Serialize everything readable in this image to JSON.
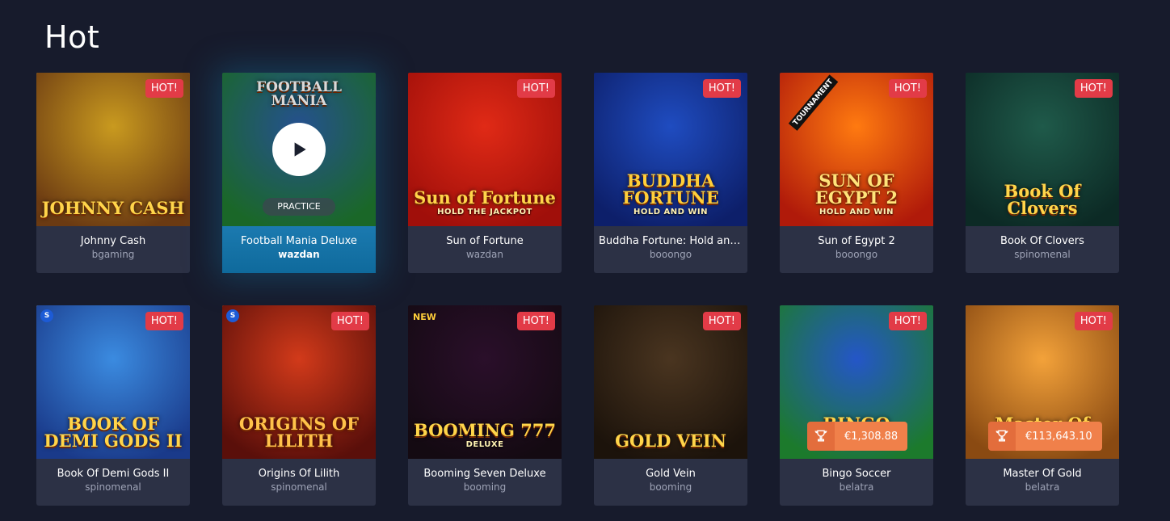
{
  "section": {
    "title": "Hot"
  },
  "games": [
    {
      "name": "Johnny Cash",
      "provider": "bgaming",
      "badge": "HOT!",
      "art_title": "JOHNNY CASH",
      "art_sub": "",
      "bg": [
        "#c99a1f",
        "#6b3a12"
      ],
      "border": "#f6c431",
      "title_color": "#ffd54a"
    },
    {
      "name": "Football Mania Deluxe",
      "provider": "wazdan",
      "badge": "",
      "art_title": "FOOTBALL MANIA",
      "art_sub": "",
      "practice": "PRACTICE",
      "bg": [
        "#2c5fa8",
        "#1f7a2f"
      ],
      "border": "",
      "title_color": "#ffffff"
    },
    {
      "name": "Sun of Fortune",
      "provider": "wazdan",
      "badge": "HOT!",
      "art_title": "Sun of Fortune",
      "art_sub": "HOLD THE JACKPOT",
      "bg": [
        "#e02a16",
        "#a00f0a"
      ],
      "border": "",
      "title_color": "#ffd54a"
    },
    {
      "name": "Buddha Fortune: Hold and ...",
      "provider": "booongo",
      "badge": "HOT!",
      "art_title": "BUDDHA FORTUNE",
      "art_sub": "HOLD AND WIN",
      "bg": [
        "#1f4cc0",
        "#0d1f6a"
      ],
      "border": "",
      "title_color": "#ffcf3a"
    },
    {
      "name": "Sun of Egypt 2",
      "provider": "booongo",
      "badge": "HOT!",
      "art_title": "SUN OF EGYPT 2",
      "art_sub": "HOLD AND WIN",
      "corner": "TOURNAMENT",
      "bg": [
        "#ff7a10",
        "#b01a0a"
      ],
      "border": "",
      "title_color": "#ffe37a"
    },
    {
      "name": "Book Of Clovers",
      "provider": "spinomenal",
      "badge": "HOT!",
      "art_title": "Book Of Clovers",
      "art_sub": "",
      "bg": [
        "#1f5a4a",
        "#0c2a25"
      ],
      "border": "",
      "title_color": "#ffd54a"
    },
    {
      "name": "Book Of Demi Gods II",
      "provider": "spinomenal",
      "badge": "HOT!",
      "art_title": "BOOK OF DEMI GODS II",
      "art_sub": "",
      "corner": "S",
      "bg": [
        "#3b8be0",
        "#1a3a8a"
      ],
      "border": "#f6c431",
      "title_color": "#ffd54a"
    },
    {
      "name": "Origins Of Lilith",
      "provider": "spinomenal",
      "badge": "HOT!",
      "art_title": "ORIGINS OF LILITH",
      "art_sub": "",
      "corner": "S",
      "bg": [
        "#d23a1a",
        "#5a0f0a"
      ],
      "border": "#f6a431",
      "title_color": "#ffc24a"
    },
    {
      "name": "Booming Seven Deluxe",
      "provider": "booming",
      "badge": "HOT!",
      "art_title": "BOOMING 777",
      "art_sub": "DELUXE",
      "corner": "NEW",
      "bg": [
        "#2a0f2a",
        "#140a12"
      ],
      "border": "",
      "title_color": "#ffd54a"
    },
    {
      "name": "Gold Vein",
      "provider": "booming",
      "badge": "HOT!",
      "art_title": "GOLD VEIN",
      "art_sub": "",
      "bg": [
        "#4a3520",
        "#1c130b"
      ],
      "border": "",
      "title_color": "#ffd54a"
    },
    {
      "name": "Bingo Soccer",
      "provider": "belatra",
      "badge": "HOT!",
      "art_title": "BINGO SOCCER",
      "art_sub": "",
      "prize": "€1,308.88",
      "bg": [
        "#2456c8",
        "#1c7a2c"
      ],
      "border": "",
      "title_color": "#ffd54a"
    },
    {
      "name": "Master Of Gold",
      "provider": "belatra",
      "badge": "HOT!",
      "art_title": "Master Of Gold",
      "art_sub": "",
      "prize": "€113,643.10",
      "bg": [
        "#f3a23a",
        "#8a4a12"
      ],
      "border": "#f6a431",
      "title_color": "#ffd54a"
    }
  ],
  "colors": {
    "background": "#171b2c",
    "card": "#2c3145",
    "hot": "#e23b47",
    "active": "#1b7ab0",
    "prize": "#f0804a"
  },
  "icons": {
    "play": "play-icon",
    "trophy": "trophy-icon"
  }
}
